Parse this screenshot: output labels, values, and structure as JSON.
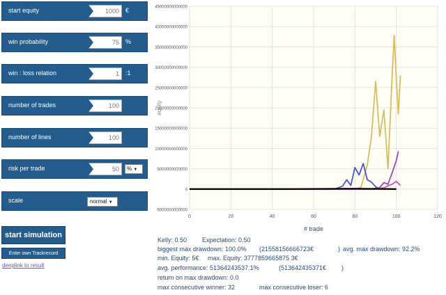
{
  "params": [
    {
      "label": "start equity",
      "value": "1000",
      "unit": "€"
    },
    {
      "label": "win probability",
      "value": "75",
      "unit": "%"
    },
    {
      "label": "win : loss relation",
      "value": "1",
      "unit": ":1"
    },
    {
      "label": "number of trades",
      "value": "100",
      "unit": ""
    },
    {
      "label": "number of lines",
      "value": "100",
      "unit": ""
    },
    {
      "label": "risk per trade",
      "value": "50",
      "unit": "",
      "select": "%"
    }
  ],
  "scale": {
    "label": "scale",
    "value": "normal"
  },
  "buttons": {
    "start_simulation": "start simulation",
    "enter_trackrecord": "Enter own Trackrecord",
    "deeplink": "deeplink to result"
  },
  "stats": {
    "kelly": "Kelly: 0.50",
    "expectation": "Expectation: 0.50",
    "biggest_max_drawdown": "biggest max drawdown: 100.0%",
    "biggest_max_drawdown_value": "(21558156666723€",
    "biggest_max_drawdown_close": ")",
    "avg_max_drawdown": "avg. max drawdown: 92.2%",
    "min_equity": "min. Equity: 5€",
    "max_equity": "max. Equity: 3777859665875 3€",
    "avg_performance": "avg. performance: 51364243537.1%",
    "avg_performance_value": "(513642435371€",
    "avg_performance_close": ")",
    "return_on_max_drawdown": "return on max drawdown: 0.0",
    "max_consecutive_winner": "max consecutive winner: 32",
    "max_consecutive_loser": "max consecutive loser: 6"
  },
  "chart_data": {
    "type": "line",
    "xlabel": "# trade",
    "ylabel": "equity",
    "xlim": [
      0,
      120
    ],
    "ylim": [
      -5000000000000,
      45000000000000
    ],
    "xticks": [
      0,
      20,
      40,
      60,
      80,
      100,
      120
    ],
    "yticks": [
      -5000000000000,
      0,
      5000000000000,
      10000000000000,
      15000000000000,
      20000000000000,
      25000000000000,
      30000000000000,
      35000000000000,
      40000000000000,
      45000000000000
    ],
    "ytick_labels": [
      "-5000000000000",
      "0",
      "5000000000000",
      "10000000000000",
      "15000000000000",
      "20000000000000",
      "25000000000000",
      "30000000000000",
      "35000000000000",
      "40000000000000",
      "45000000000000"
    ],
    "grid": true,
    "colors": {
      "gold": "#d9bd5b",
      "blue": "#4a56c8",
      "purple": "#a246b4",
      "pink": "#e0509a",
      "black": "#111111"
    },
    "series": [
      {
        "color": "#d9bd5b",
        "x": [
          0,
          80,
          83,
          86,
          88,
          90,
          92,
          94,
          96,
          98,
          99,
          100,
          101,
          102
        ],
        "y": [
          0,
          0,
          500000000000,
          6000000000000,
          13000000000000,
          26500000000000,
          13000000000000,
          19500000000000,
          5000000000000,
          28000000000000,
          37800000000000,
          27000000000000,
          18500000000000,
          28000000000000
        ]
      },
      {
        "color": "#4a56c8",
        "x": [
          0,
          70,
          74,
          76,
          78,
          80,
          82,
          84,
          86,
          88,
          90,
          92
        ],
        "y": [
          0,
          0,
          700000000000,
          2300000000000,
          900000000000,
          5300000000000,
          3500000000000,
          6300000000000,
          2300000000000,
          1700000000000,
          600000000000,
          0
        ]
      },
      {
        "color": "#a246b4",
        "x": [
          0,
          88,
          92,
          94,
          96,
          98,
          100,
          101
        ],
        "y": [
          0,
          0,
          400000000000,
          1600000000000,
          1200000000000,
          4000000000000,
          7000000000000,
          9300000000000
        ]
      },
      {
        "color": "#e0509a",
        "x": [
          0,
          90,
          94,
          96,
          98,
          100,
          102
        ],
        "y": [
          0,
          0,
          300000000000,
          800000000000,
          1200000000000,
          1900000000000,
          900000000000
        ]
      },
      {
        "color": "#111111",
        "x": [
          0,
          50,
          80,
          100
        ],
        "y": [
          0,
          0,
          100000000000,
          0
        ]
      }
    ]
  }
}
